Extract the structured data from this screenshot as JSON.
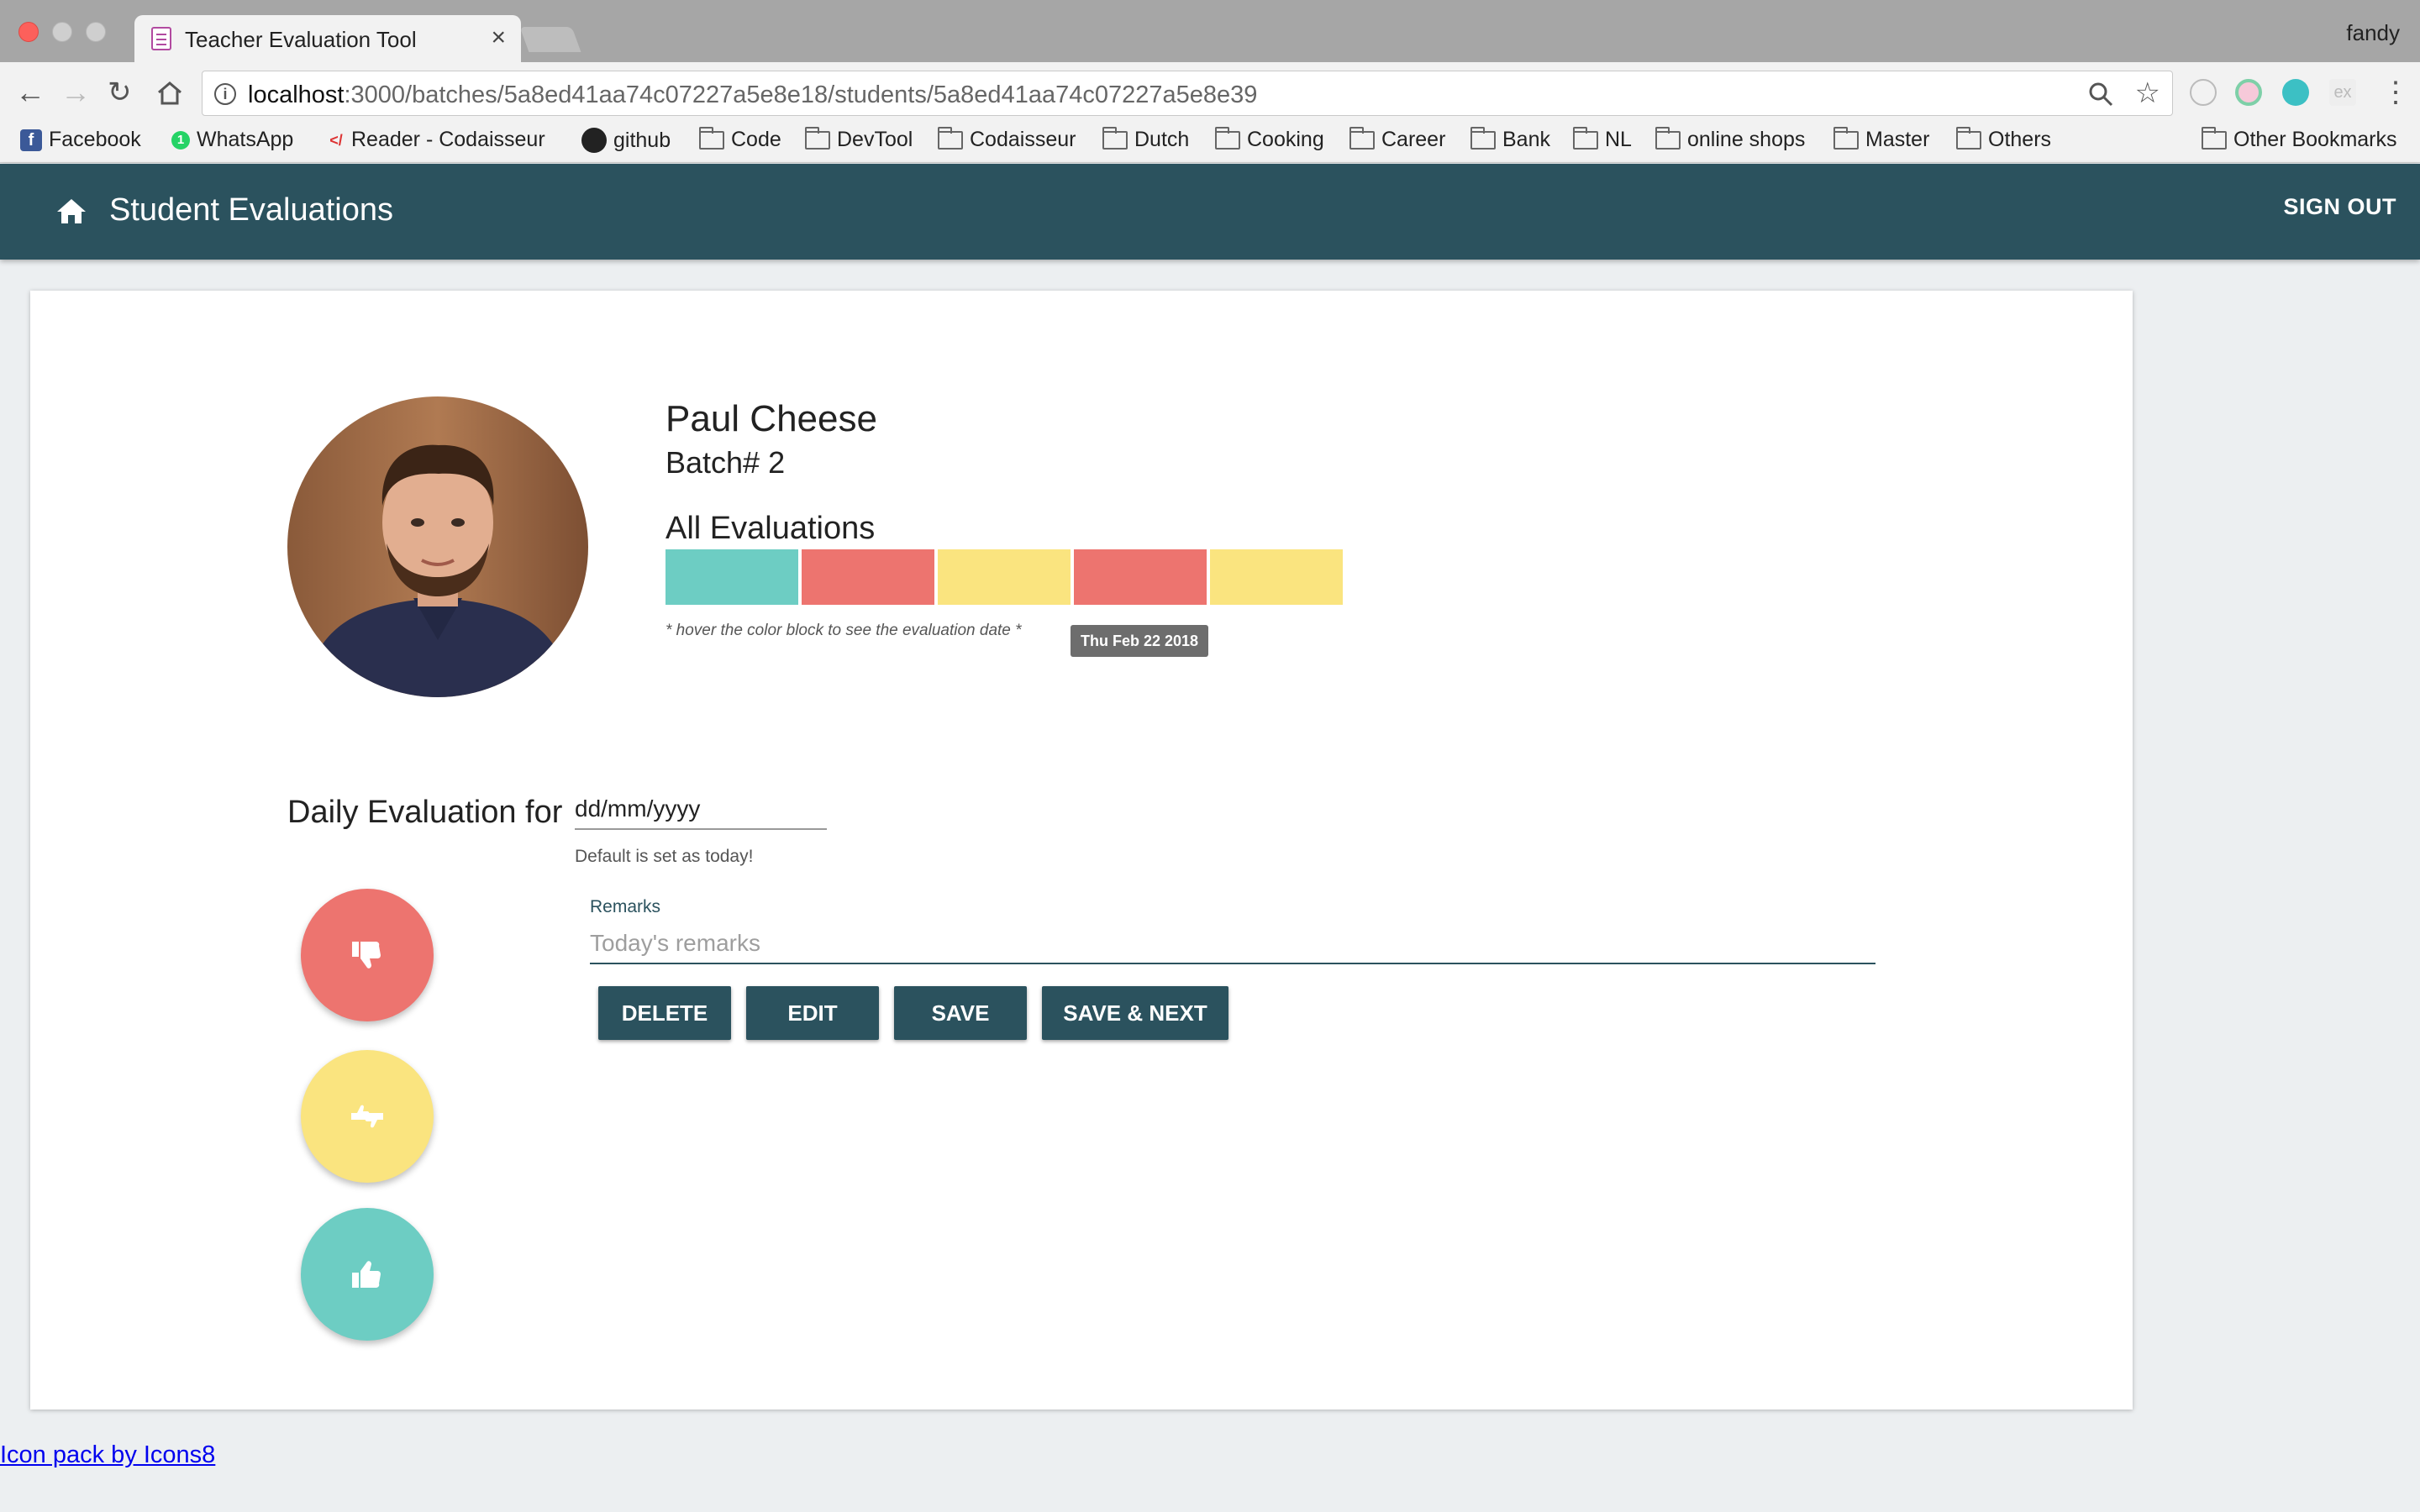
{
  "browser": {
    "tab_title": "Teacher Evaluation Tool",
    "tab_close": "×",
    "profile_name": "fandy",
    "url_host": "localhost",
    "url_path": ":3000/batches/5a8ed41aa74c07227a5e8e18/students/5a8ed41aa74c07227a5e8e39",
    "bookmarks": [
      {
        "label": "Facebook",
        "icon": "facebook-icon"
      },
      {
        "label": "WhatsApp",
        "icon": "whatsapp-icon"
      },
      {
        "label": "Reader - Codaisseur",
        "icon": "reader-icon"
      },
      {
        "label": "github",
        "icon": "github-icon"
      },
      {
        "label": "Code",
        "icon": "folder-icon"
      },
      {
        "label": "DevTool",
        "icon": "folder-icon"
      },
      {
        "label": "Codaisseur",
        "icon": "folder-icon"
      },
      {
        "label": "Dutch",
        "icon": "folder-icon"
      },
      {
        "label": "Cooking",
        "icon": "folder-icon"
      },
      {
        "label": "Career",
        "icon": "folder-icon"
      },
      {
        "label": "Bank",
        "icon": "folder-icon"
      },
      {
        "label": "NL",
        "icon": "folder-icon"
      },
      {
        "label": "online shops",
        "icon": "folder-icon"
      },
      {
        "label": "Master",
        "icon": "folder-icon"
      },
      {
        "label": "Others",
        "icon": "folder-icon"
      }
    ],
    "other_bookmarks": "Other Bookmarks"
  },
  "appbar": {
    "title": "Student Evaluations",
    "signout_label": "SIGN OUT",
    "color": "#2b525e"
  },
  "student": {
    "name": "Paul Cheese",
    "batch": "Batch# 2",
    "evaluations_title": "All Evaluations",
    "evaluations": [
      {
        "color": "#6dcdc3"
      },
      {
        "color": "#ed746f"
      },
      {
        "color": "#fae47f"
      },
      {
        "color": "#ed746f"
      },
      {
        "color": "#fae47f"
      }
    ],
    "hover_hint": "* hover the color block to see the evaluation date *",
    "tooltip_date": "Thu Feb 22 2018"
  },
  "daily": {
    "label": "Daily Evaluation for",
    "date_value": "dd/mm/yyyy",
    "date_helper": "Default is set as today!",
    "remarks_label": "Remarks",
    "remarks_placeholder": "Today's remarks"
  },
  "ratings": [
    {
      "name": "red-rating-button",
      "icon": "thumbs-down-icon",
      "color": "#ed746f"
    },
    {
      "name": "yellow-rating-button",
      "icon": "thumbs-sideways-icon",
      "color": "#fae47f"
    },
    {
      "name": "green-rating-button",
      "icon": "thumbs-up-icon",
      "color": "#6dcdc3"
    }
  ],
  "actions": {
    "delete": "DELETE",
    "edit": "EDIT",
    "save": "SAVE",
    "save_next": "SAVE & NEXT"
  },
  "footer": {
    "credit": "Icon pack by Icons8"
  }
}
